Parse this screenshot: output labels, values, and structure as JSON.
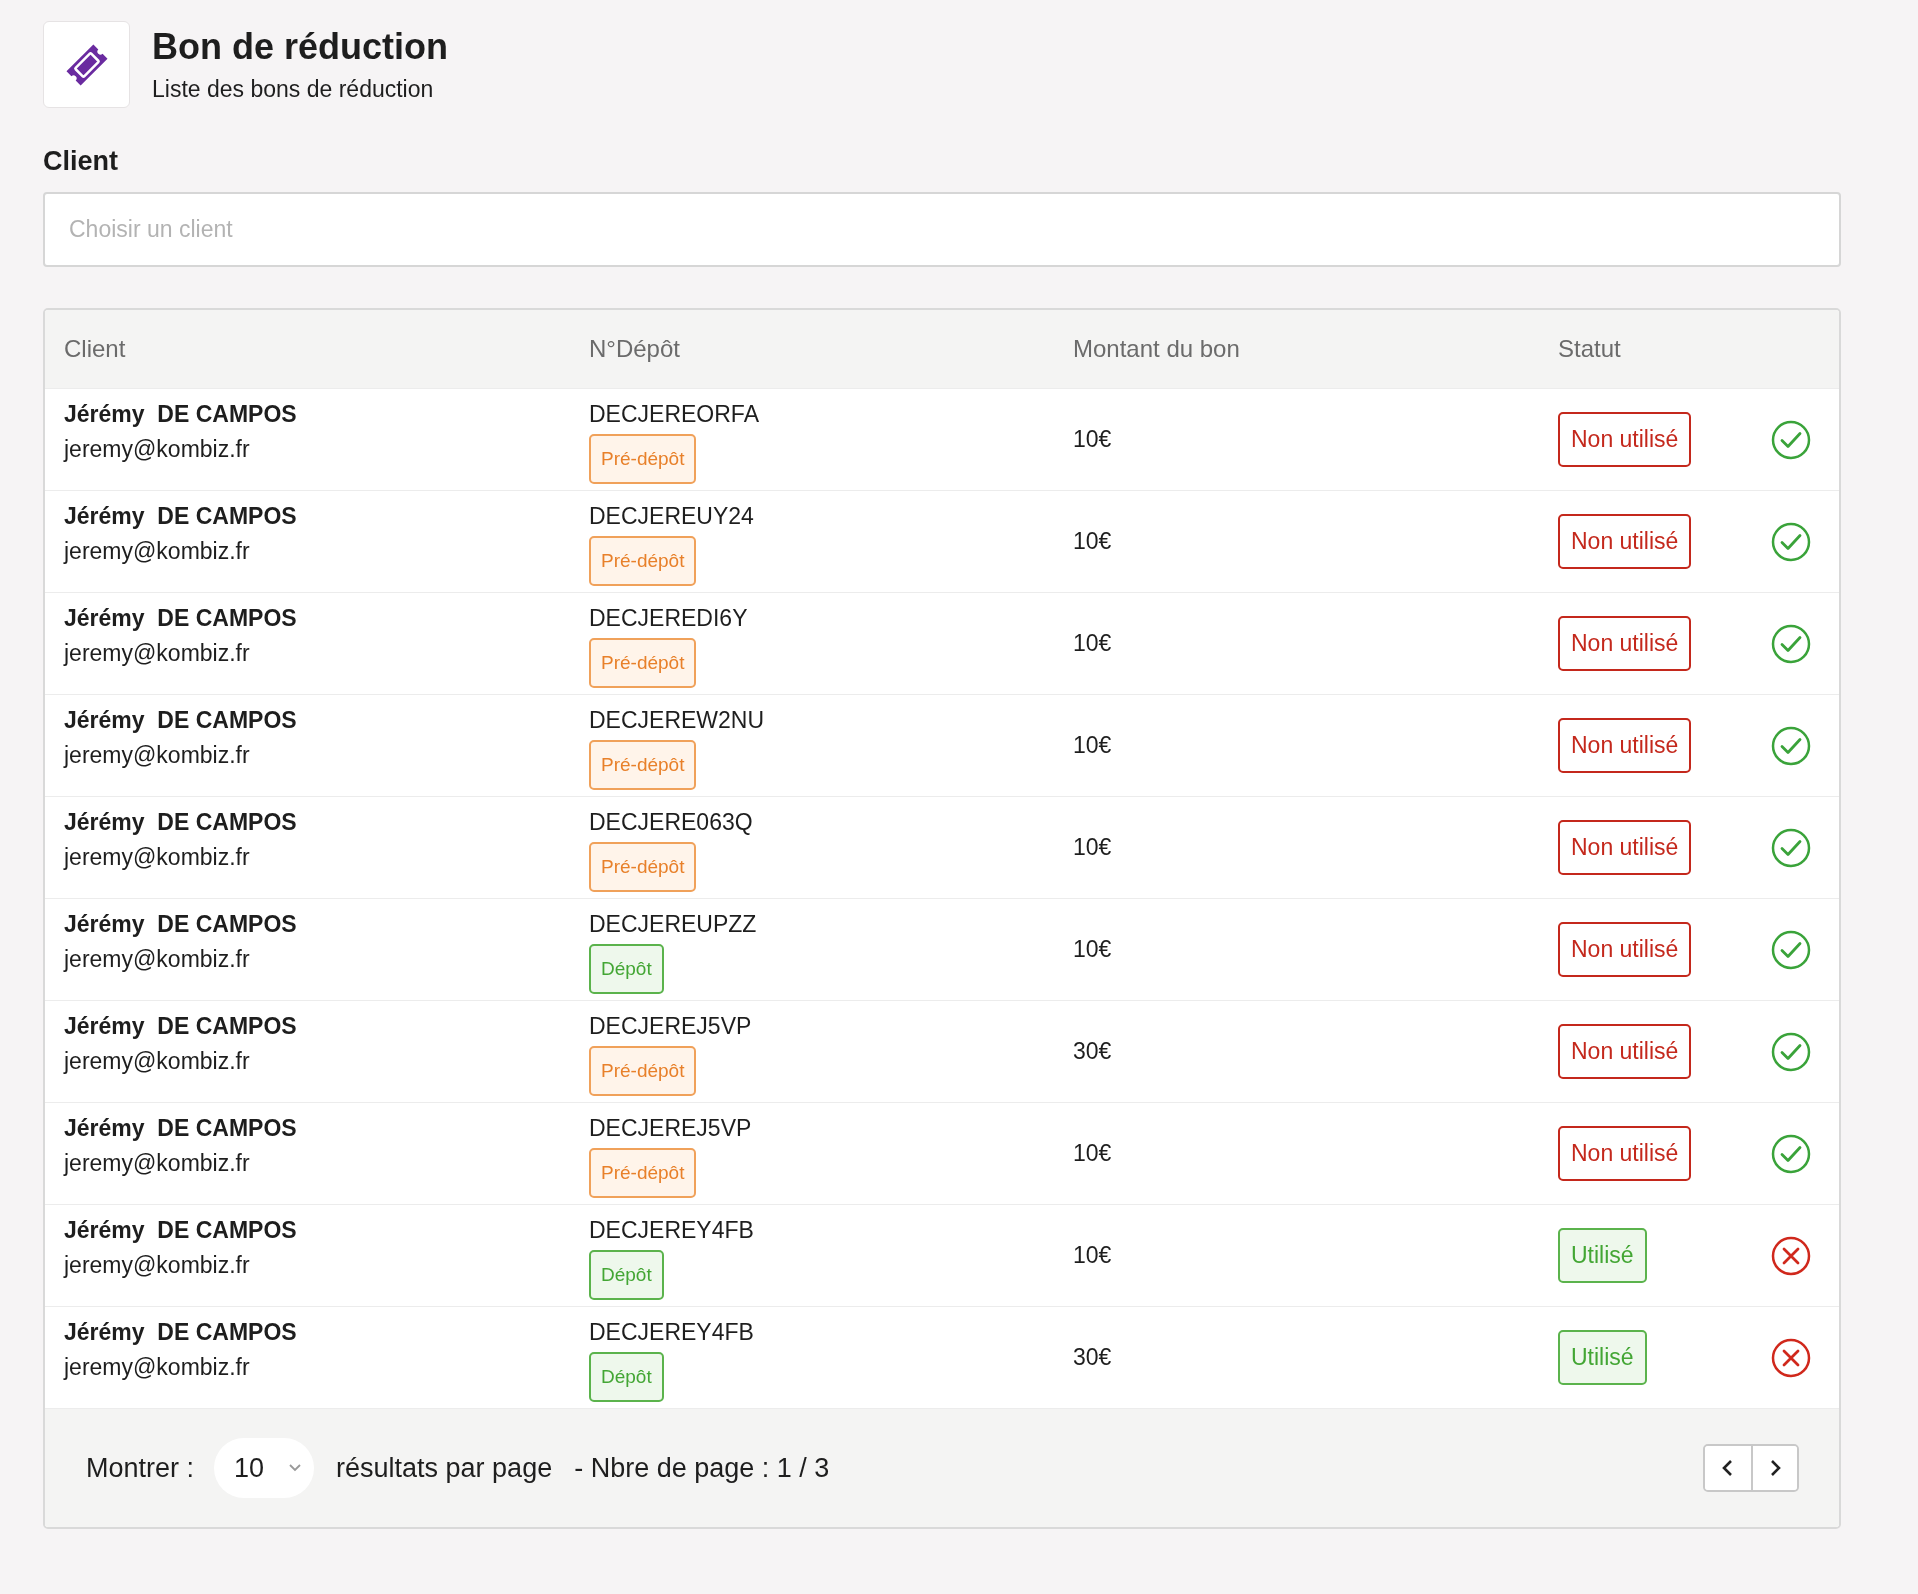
{
  "header": {
    "title": "Bon de réduction",
    "subtitle": "Liste des bons de réduction"
  },
  "client_filter": {
    "label": "Client",
    "placeholder": "Choisir un client"
  },
  "table": {
    "columns": [
      "Client",
      "N°Dépôt",
      "Montant du bon",
      "Statut"
    ],
    "rows": [
      {
        "name": "Jérémy  DE CAMPOS",
        "email": "jeremy@kombiz.fr",
        "deposit": "DECJEREORFA",
        "deposit_tag": {
          "kind": "pre",
          "label": "Pré-dépôt"
        },
        "amount": "10€",
        "status": {
          "used": false,
          "label": "Non utilisé"
        }
      },
      {
        "name": "Jérémy  DE CAMPOS",
        "email": "jeremy@kombiz.fr",
        "deposit": "DECJEREUY24",
        "deposit_tag": {
          "kind": "pre",
          "label": "Pré-dépôt"
        },
        "amount": "10€",
        "status": {
          "used": false,
          "label": "Non utilisé"
        }
      },
      {
        "name": "Jérémy  DE CAMPOS",
        "email": "jeremy@kombiz.fr",
        "deposit": "DECJEREDI6Y",
        "deposit_tag": {
          "kind": "pre",
          "label": "Pré-dépôt"
        },
        "amount": "10€",
        "status": {
          "used": false,
          "label": "Non utilisé"
        }
      },
      {
        "name": "Jérémy  DE CAMPOS",
        "email": "jeremy@kombiz.fr",
        "deposit": "DECJEREW2NU",
        "deposit_tag": {
          "kind": "pre",
          "label": "Pré-dépôt"
        },
        "amount": "10€",
        "status": {
          "used": false,
          "label": "Non utilisé"
        }
      },
      {
        "name": "Jérémy  DE CAMPOS",
        "email": "jeremy@kombiz.fr",
        "deposit": "DECJERE063Q",
        "deposit_tag": {
          "kind": "pre",
          "label": "Pré-dépôt"
        },
        "amount": "10€",
        "status": {
          "used": false,
          "label": "Non utilisé"
        }
      },
      {
        "name": "Jérémy  DE CAMPOS",
        "email": "jeremy@kombiz.fr",
        "deposit": "DECJEREUPZZ",
        "deposit_tag": {
          "kind": "final",
          "label": "Dépôt"
        },
        "amount": "10€",
        "status": {
          "used": false,
          "label": "Non utilisé"
        }
      },
      {
        "name": "Jérémy  DE CAMPOS",
        "email": "jeremy@kombiz.fr",
        "deposit": "DECJEREJ5VP",
        "deposit_tag": {
          "kind": "pre",
          "label": "Pré-dépôt"
        },
        "amount": "30€",
        "status": {
          "used": false,
          "label": "Non utilisé"
        }
      },
      {
        "name": "Jérémy  DE CAMPOS",
        "email": "jeremy@kombiz.fr",
        "deposit": "DECJEREJ5VP",
        "deposit_tag": {
          "kind": "pre",
          "label": "Pré-dépôt"
        },
        "amount": "10€",
        "status": {
          "used": false,
          "label": "Non utilisé"
        }
      },
      {
        "name": "Jérémy  DE CAMPOS",
        "email": "jeremy@kombiz.fr",
        "deposit": "DECJEREY4FB",
        "deposit_tag": {
          "kind": "final",
          "label": "Dépôt"
        },
        "amount": "10€",
        "status": {
          "used": true,
          "label": "Utilisé"
        }
      },
      {
        "name": "Jérémy  DE CAMPOS",
        "email": "jeremy@kombiz.fr",
        "deposit": "DECJEREY4FB",
        "deposit_tag": {
          "kind": "final",
          "label": "Dépôt"
        },
        "amount": "30€",
        "status": {
          "used": true,
          "label": "Utilisé"
        }
      }
    ]
  },
  "pagination": {
    "show_label": "Montrer :",
    "page_size": "10",
    "per_page_label": "résultats par page",
    "pages_label": "- Nbre de page : 1 / 3"
  }
}
